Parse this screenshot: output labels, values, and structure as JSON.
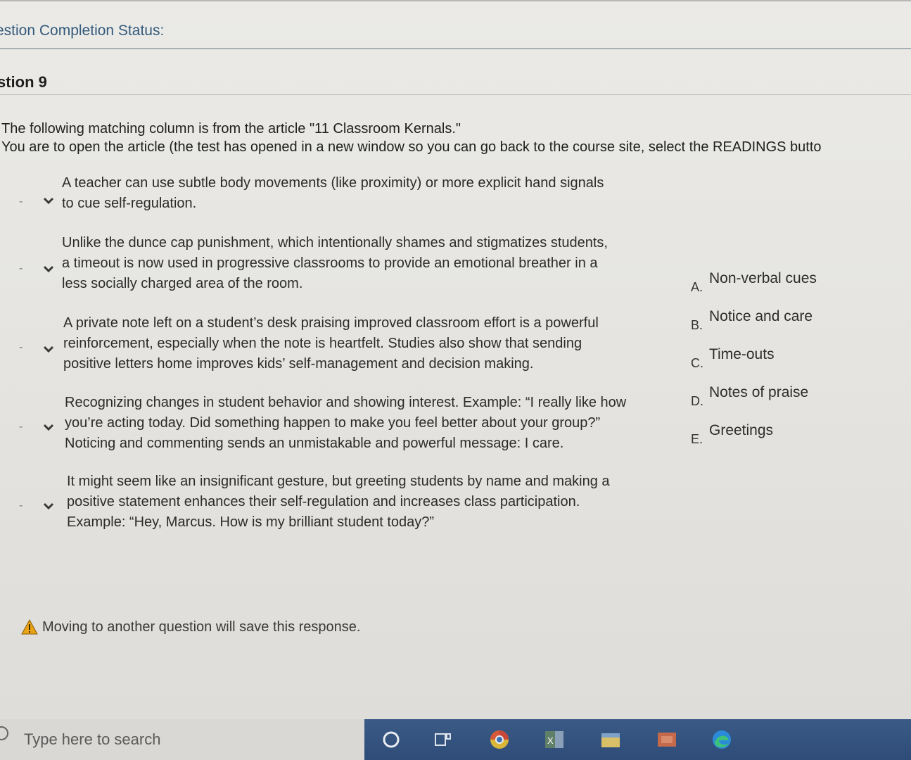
{
  "status": {
    "label": "estion Completion Status:"
  },
  "question": {
    "title": "stion 9"
  },
  "instructions": {
    "line1": "The following matching column is from the article \"11 Classroom Kernals.\"",
    "line2": "You are to open the article (the test has opened in a new window so you can go back to the course site, select the READINGS butto"
  },
  "prompts": [
    {
      "dash": "-",
      "text": "A teacher can use subtle body movements (like proximity) or more explicit hand signals\nto cue self-regulation."
    },
    {
      "dash": "-",
      "text": "Unlike the dunce cap punishment, which intentionally shames and stigmatizes students,\na timeout is now used in progressive classrooms to provide an emotional breather in a\nless socially charged area of the room."
    },
    {
      "dash": "-",
      "text": "A private note left on a student’s desk praising improved classroom effort is a powerful\nreinforcement, especially when the note is heartfelt. Studies also show that sending\npositive letters home improves kids’ self-management and decision making."
    },
    {
      "dash": "-",
      "text": "Recognizing changes in student behavior and showing interest. Example: “I really like how\nyou’re acting today. Did something happen to make you feel better about your group?”\nNoticing and commenting sends an unmistakable and powerful message: I care."
    },
    {
      "dash": "-",
      "text": "It might seem like an insignificant gesture, but greeting students by name and making a\npositive statement enhances their self-regulation and increases class participation.\nExample: “Hey, Marcus. How is my brilliant student today?”"
    }
  ],
  "answers": [
    {
      "letter": "A.",
      "text": "Non-verbal cues"
    },
    {
      "letter": "B.",
      "text": "Notice and care"
    },
    {
      "letter": "C.",
      "text": "Time-outs"
    },
    {
      "letter": "D.",
      "text": "Notes of praise"
    },
    {
      "letter": "E.",
      "text": "Greetings"
    }
  ],
  "warning": {
    "text": "Moving to another question will save this response."
  },
  "taskbar": {
    "search_placeholder": "Type here to search",
    "icons": [
      "cortana-icon",
      "task-view-icon",
      "chrome-icon",
      "excel-icon",
      "file-explorer-icon",
      "app-icon",
      "edge-icon"
    ]
  },
  "colors": {
    "status_text": "#345a7c",
    "taskbar": "#2f4c78",
    "warning": "#e8a317"
  }
}
